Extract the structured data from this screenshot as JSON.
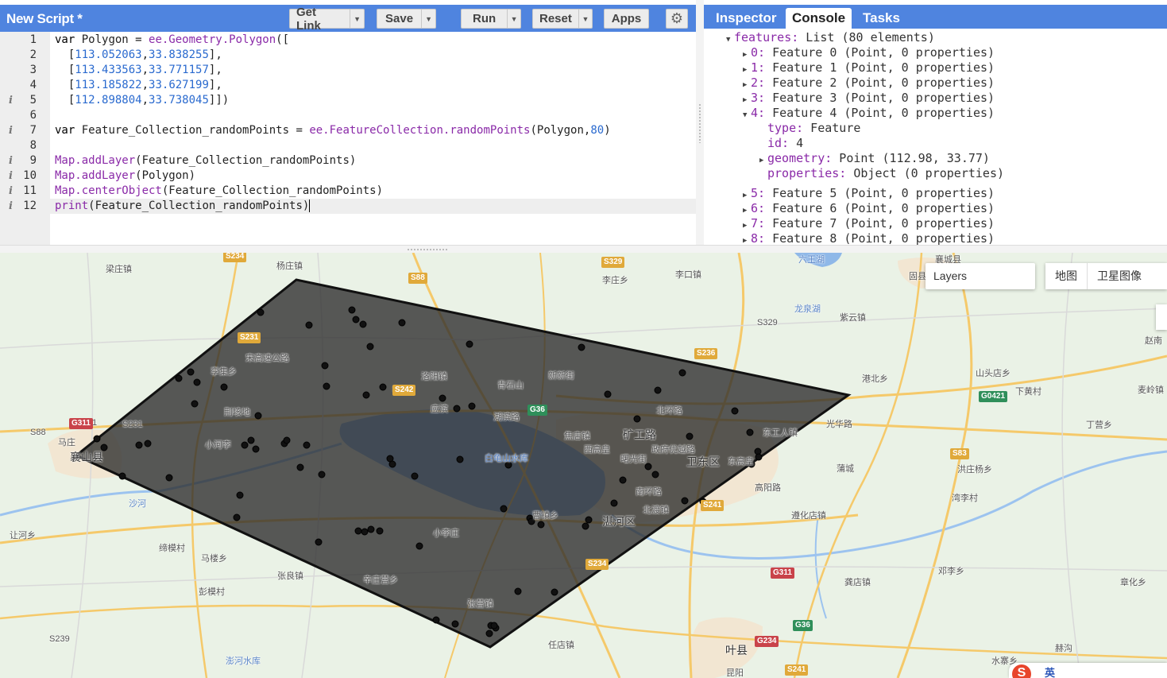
{
  "editor": {
    "title": "New Script *",
    "buttons": {
      "get_link": "Get Link",
      "save": "Save",
      "run": "Run",
      "reset": "Reset",
      "apps": "Apps"
    },
    "code_lines": [
      {
        "n": "1",
        "info": false,
        "text": "var Polygon = ee.Geometry.Polygon(["
      },
      {
        "n": "2",
        "info": false,
        "text": "  [113.052063,33.838255],"
      },
      {
        "n": "3",
        "info": false,
        "text": "  [113.433563,33.771157],"
      },
      {
        "n": "4",
        "info": false,
        "text": "  [113.185822,33.627199],"
      },
      {
        "n": "5",
        "info": true,
        "text": "  [112.898804,33.738045]])"
      },
      {
        "n": "6",
        "info": false,
        "text": ""
      },
      {
        "n": "7",
        "info": true,
        "text": "var Feature_Collection_randomPoints = ee.FeatureCollection.randomPoints(Polygon,80)"
      },
      {
        "n": "8",
        "info": false,
        "text": ""
      },
      {
        "n": "9",
        "info": true,
        "text": "Map.addLayer(Feature_Collection_randomPoints)"
      },
      {
        "n": "10",
        "info": true,
        "text": "Map.addLayer(Polygon)"
      },
      {
        "n": "11",
        "info": true,
        "text": "Map.centerObject(Feature_Collection_randomPoints)"
      },
      {
        "n": "12",
        "info": true,
        "text": "print(Feature_Collection_randomPoints)"
      }
    ]
  },
  "right_panel": {
    "tabs": [
      "Inspector",
      "Console",
      "Tasks"
    ],
    "selected_tab": "Console",
    "console_lines": [
      {
        "indent": 0,
        "expanded": true,
        "key": "features:",
        "text": " List (80 elements)"
      },
      {
        "indent": 1,
        "expanded": false,
        "key": "0:",
        "text": " Feature 0 (Point, 0 properties)"
      },
      {
        "indent": 1,
        "expanded": false,
        "key": "1:",
        "text": " Feature 1 (Point, 0 properties)"
      },
      {
        "indent": 1,
        "expanded": false,
        "key": "2:",
        "text": " Feature 2 (Point, 0 properties)"
      },
      {
        "indent": 1,
        "expanded": false,
        "key": "3:",
        "text": " Feature 3 (Point, 0 properties)"
      },
      {
        "indent": 1,
        "expanded": true,
        "key": "4:",
        "text": " Feature 4 (Point, 0 properties)"
      },
      {
        "indent": 2,
        "leaf": true,
        "key": "type:",
        "text": " Feature"
      },
      {
        "indent": 2,
        "leaf": true,
        "key": "id:",
        "text": " 4"
      },
      {
        "indent": 2,
        "expanded": false,
        "key": "geometry:",
        "text": " Point (112.98, 33.77)"
      },
      {
        "indent": 2,
        "leaf": true,
        "key": "properties:",
        "text": " Object (0 properties)"
      },
      {
        "indent": 1,
        "expanded": false,
        "key": "5:",
        "text": " Feature 5 (Point, 0 properties)"
      },
      {
        "indent": 1,
        "expanded": false,
        "key": "6:",
        "text": " Feature 6 (Point, 0 properties)"
      },
      {
        "indent": 1,
        "expanded": false,
        "key": "7:",
        "text": " Feature 7 (Point, 0 properties)"
      },
      {
        "indent": 1,
        "expanded": false,
        "key": "8:",
        "text": " Feature 8 (Point, 0 properties)"
      }
    ]
  },
  "map": {
    "layers_label": "Layers",
    "map_types": [
      "地图",
      "卫星图像"
    ],
    "ime": {
      "logo": "S",
      "label": "英"
    },
    "colors": {
      "land": "#eaf2e6",
      "polygon_fill": "#2b2b2b",
      "water": "#8fb8e8",
      "road_major": "#f5c96a",
      "urban": "#f2e6d2"
    },
    "place_labels": [
      "梁庄镇",
      "杨庄镇",
      "李庄乡",
      "李口镇",
      "六王湖",
      "襄城县",
      "固县",
      "龙泉湖",
      "紫云镇",
      "S329",
      "孪集乡",
      "宋高速公路",
      "荆垓地",
      "小河李",
      "马庄",
      "襄山县",
      "沙河",
      "让河乡",
      "缔模村",
      "马楼乡",
      "彭模村",
      "张良镇",
      "澎河水库",
      "S239",
      "S231",
      "S242",
      "S88",
      "G311",
      "洛阳镇",
      "青石山",
      "新新街",
      "应滨",
      "湖滨路",
      "白龟山水库",
      "焦店镇",
      "西高皇",
      "曙光街",
      "矿工路",
      "北环路",
      "政府优越路",
      "卫东区",
      "东高皇",
      "东工人镇",
      "光华路",
      "蒲城",
      "洪庄杨乡",
      "丁营乡",
      "下黄村",
      "麦岭镇",
      "赵南",
      "港北乡",
      "山头店乡",
      "遵化店镇",
      "高阳路",
      "南环路",
      "北渡镇",
      "湛河区",
      "曹镇乡",
      "小李庄",
      "辛庄营乡",
      "张营镇",
      "任店镇",
      "叶县",
      "龚店镇",
      "邓李乡",
      "湾李村",
      "章化乡",
      "水寨乡",
      "赫沟",
      "昆阳"
    ],
    "shields": [
      "S234",
      "S88",
      "S329",
      "S231",
      "G311",
      "S242",
      "S236",
      "G36",
      "S241",
      "S83",
      "G0421",
      "S234",
      "G311",
      "G36",
      "G234",
      "S241"
    ]
  }
}
